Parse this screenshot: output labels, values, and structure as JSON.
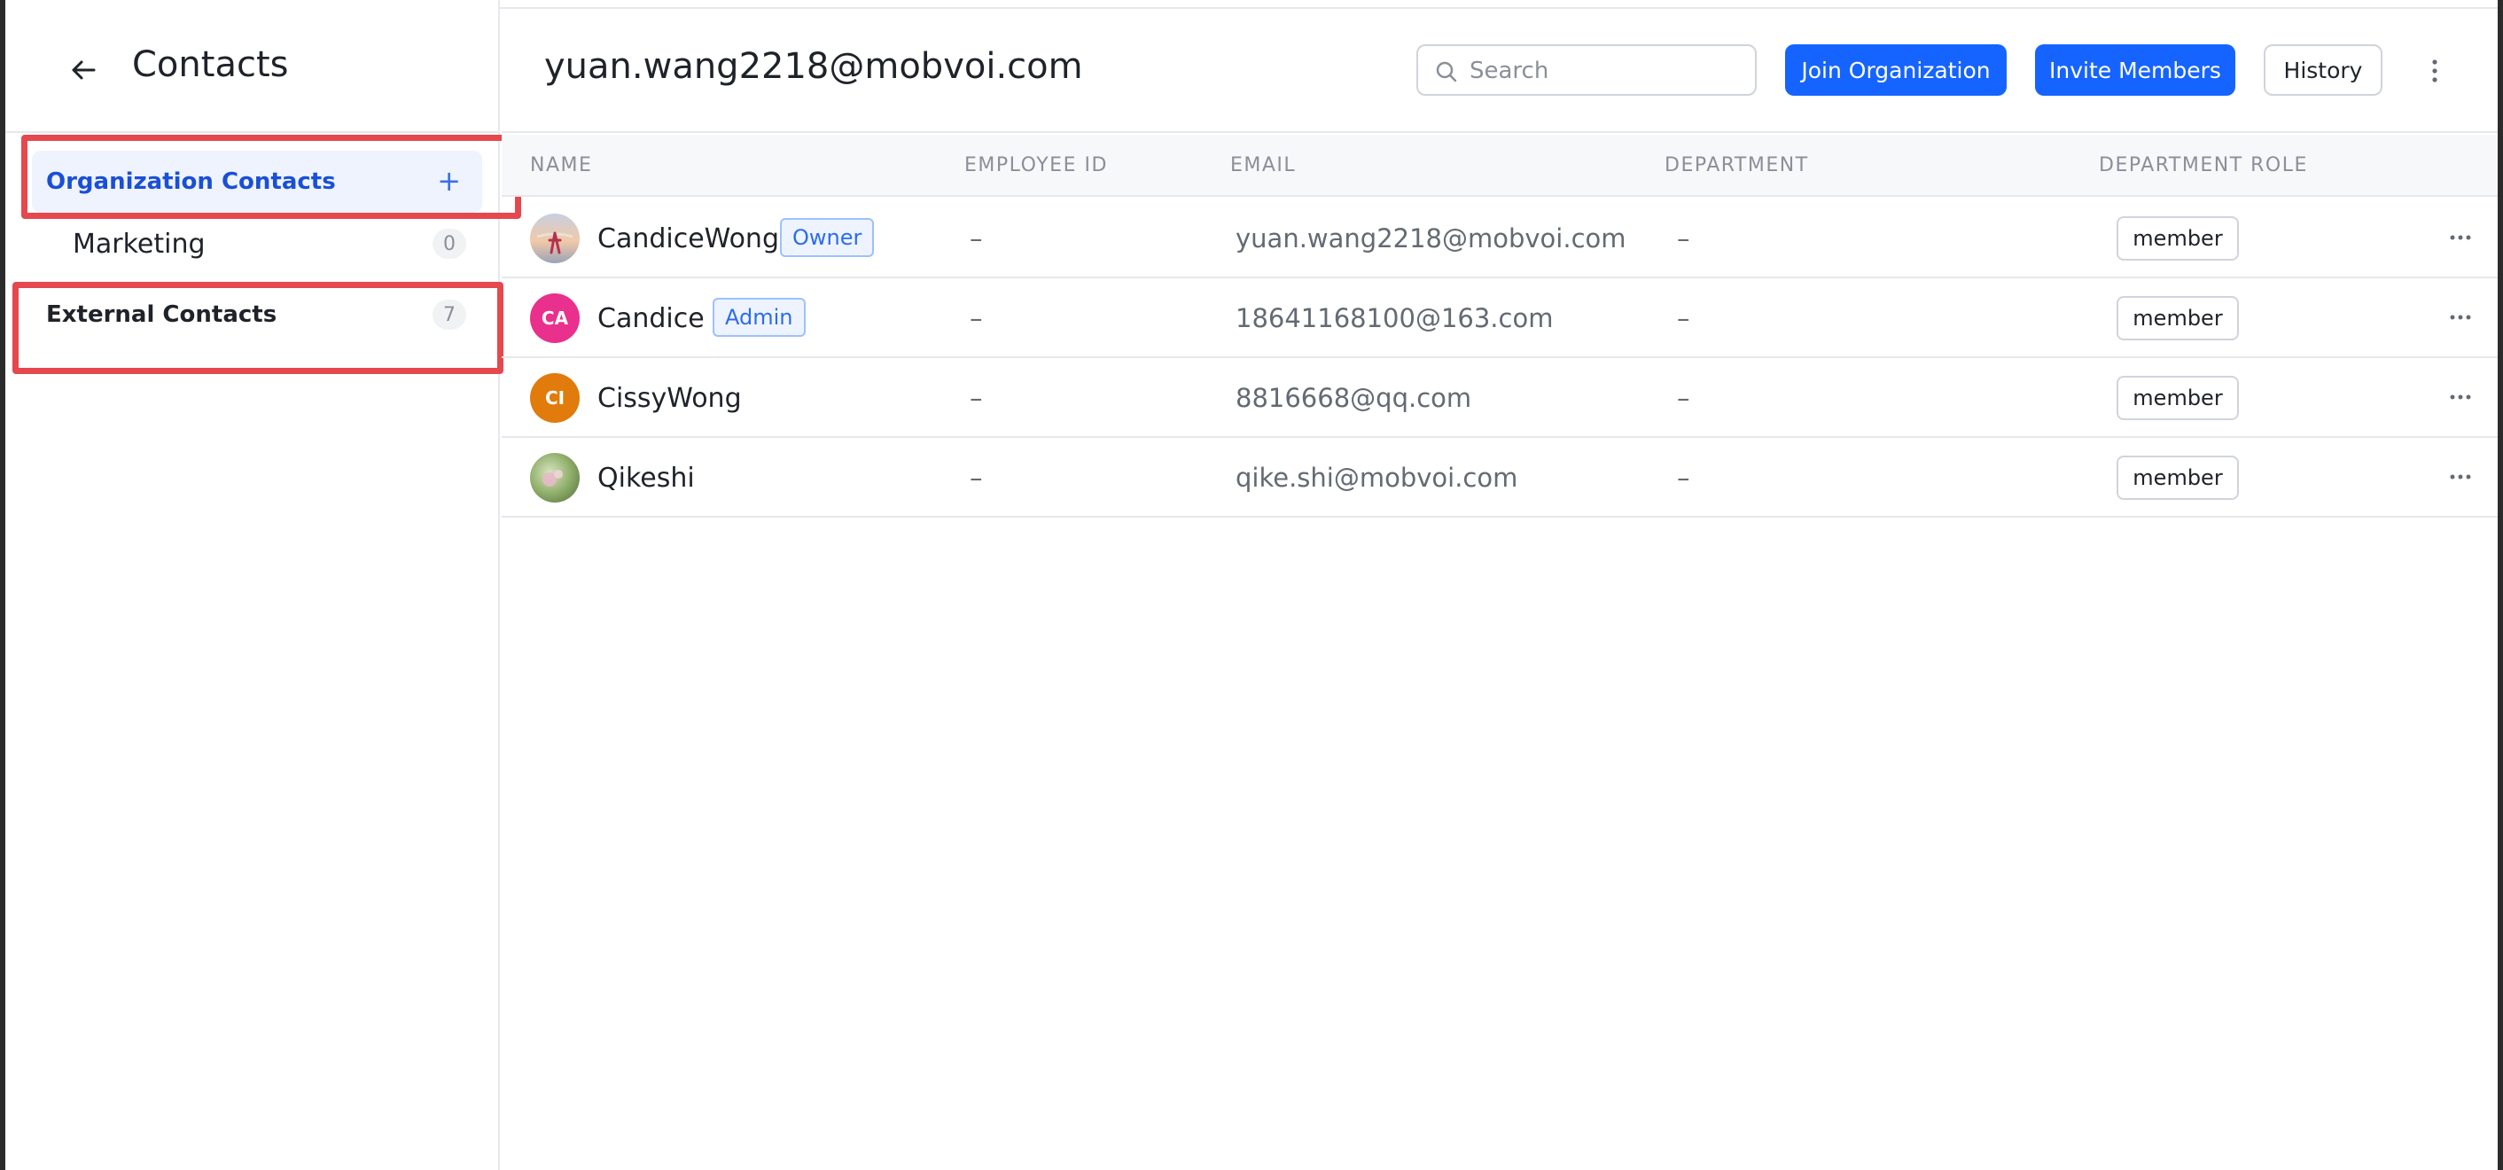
{
  "sidebar": {
    "title": "Contacts",
    "org_contacts": {
      "label": "Organization Contacts",
      "add_symbol": "+"
    },
    "department": {
      "label": "Marketing",
      "count": "0"
    },
    "external_contacts": {
      "label": "External Contacts",
      "count": "7"
    }
  },
  "header": {
    "title": "yuan.wang2218@mobvoi.com",
    "search_placeholder": "Search",
    "join_label": "Join Organization",
    "invite_label": "Invite Members",
    "history_label": "History"
  },
  "table": {
    "columns": [
      "NAME",
      "EMPLOYEE ID",
      "EMAIL",
      "DEPARTMENT",
      "DEPARTMENT ROLE"
    ],
    "rows": [
      {
        "name": "CandiceWong",
        "tag": "Owner",
        "employee_id": "–",
        "email": "yuan.wang2218@mobvoi.com",
        "department": "–",
        "role": "member",
        "avatar": "photo",
        "avatar_initials": ""
      },
      {
        "name": "Candice",
        "tag": "Admin",
        "employee_id": "–",
        "email": "18641168100@163.com",
        "department": "–",
        "role": "member",
        "avatar": "initials",
        "avatar_initials": "CA",
        "avatar_color": "#e8308c"
      },
      {
        "name": "CissyWong",
        "tag": "",
        "employee_id": "–",
        "email": "8816668@qq.com",
        "department": "–",
        "role": "member",
        "avatar": "initials",
        "avatar_initials": "CI",
        "avatar_color": "#e07b0c"
      },
      {
        "name": "Qikeshi",
        "tag": "",
        "employee_id": "–",
        "email": "qike.shi@mobvoi.com",
        "department": "–",
        "role": "member",
        "avatar": "photo",
        "avatar_initials": ""
      }
    ]
  },
  "colors": {
    "primary": "#1664ff",
    "highlight": "#e5484d",
    "selected_bg": "#eef3fe"
  }
}
